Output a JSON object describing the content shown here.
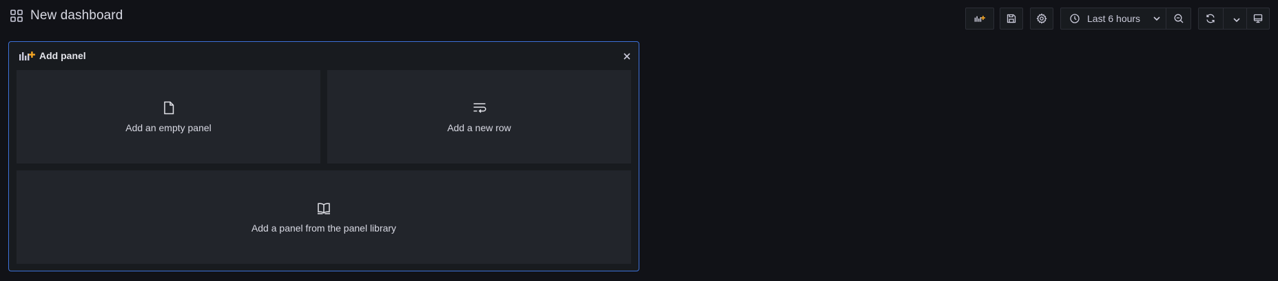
{
  "header": {
    "title": "New dashboard",
    "title_icon": "apps-grid-icon"
  },
  "toolbar": {
    "buttons": [
      {
        "name": "add-panel-button",
        "icon": "add-panel-icon"
      },
      {
        "name": "save-dashboard-button",
        "icon": "save-icon"
      },
      {
        "name": "dashboard-settings-button",
        "icon": "gear-icon"
      },
      {
        "name": "time-picker-button",
        "icon": "clock-icon"
      },
      {
        "name": "zoom-out-button",
        "icon": "zoom-out-icon"
      },
      {
        "name": "refresh-button",
        "icon": "refresh-icon"
      },
      {
        "name": "refresh-interval-dropdown",
        "icon": "chevron-down-icon"
      },
      {
        "name": "tv-mode-button",
        "icon": "monitor-icon"
      }
    ],
    "time_range_label": "Last 6 hours"
  },
  "add_panel": {
    "title": "Add panel",
    "options": [
      {
        "label": "Add an empty panel",
        "icon": "file-blank-icon"
      },
      {
        "label": "Add a new row",
        "icon": "wrap-text-icon"
      },
      {
        "label": "Add a panel from the panel library",
        "icon": "book-open-icon"
      }
    ]
  },
  "colors": {
    "background": "#111217",
    "card": "#181b1f",
    "option": "#22252b",
    "border_accent": "#3d71d9",
    "icon_accent": "#f5a623"
  }
}
